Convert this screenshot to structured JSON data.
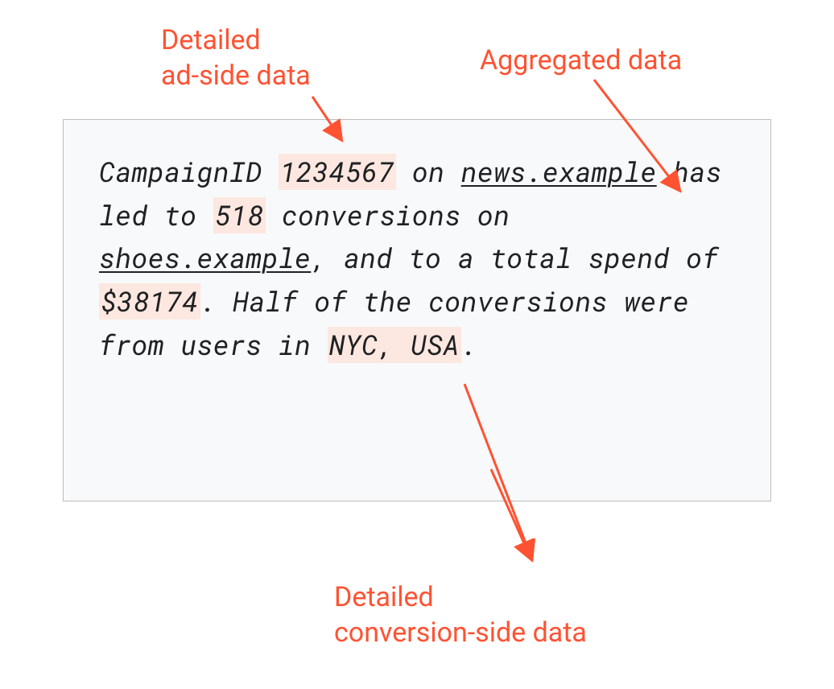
{
  "labels": {
    "top_left_line1": "Detailed",
    "top_left_line2": "ad-side data",
    "top_right": "Aggregated data",
    "bottom_line1": "Detailed",
    "bottom_line2": "conversion-side data"
  },
  "content": {
    "text_1": "CampaignID ",
    "campaign_id": "1234567",
    "text_2": " on ",
    "site1": "news.example",
    "text_3": " has led to ",
    "conversions": "518",
    "text_4": " conversions on ",
    "site2": "shoes.example",
    "text_5": ", and to a total spend of ",
    "spend": "$38174",
    "text_6": ". Half of the conversions were from users in ",
    "location": "NYC, USA",
    "text_7": "."
  },
  "colors": {
    "accent": "#ff5232",
    "highlight": "#fce8e0",
    "box_bg": "#f8f9fa",
    "box_border": "#bdbdbd"
  }
}
